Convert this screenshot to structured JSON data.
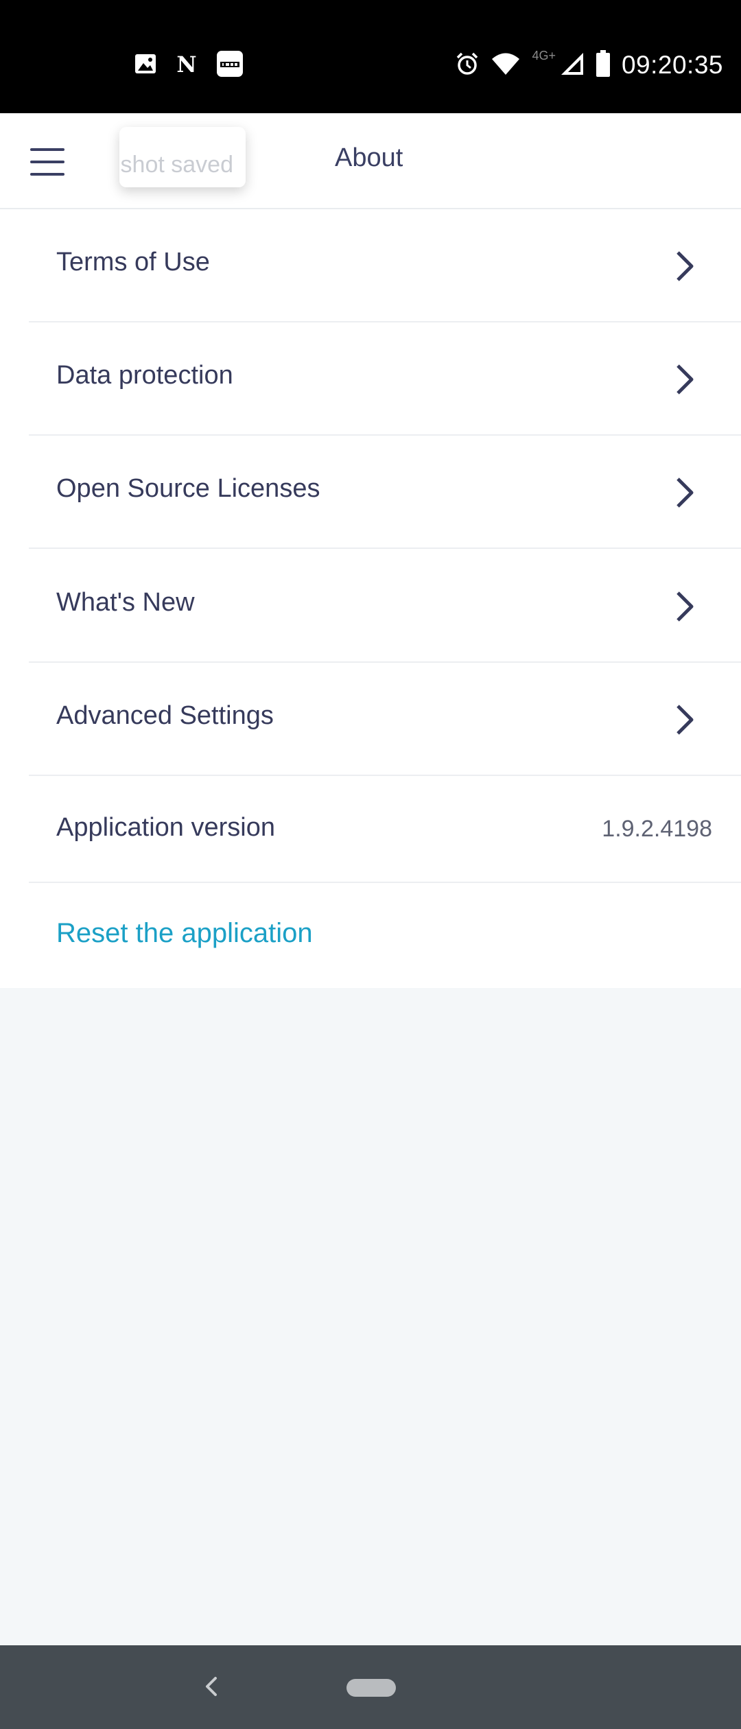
{
  "status_bar": {
    "time": "09:20:35",
    "network_label": "4G+",
    "left_icons": [
      "image-icon",
      "n-app-icon",
      "ifttt-icon"
    ],
    "right_icons": [
      "alarm-icon",
      "wifi-icon",
      "signal-icon",
      "battery-icon"
    ]
  },
  "app_bar": {
    "title": "About",
    "toast": "shot saved"
  },
  "menu": {
    "items": [
      {
        "label": "Terms of Use"
      },
      {
        "label": "Data protection"
      },
      {
        "label": "Open Source Licenses"
      },
      {
        "label": "What's New"
      },
      {
        "label": "Advanced Settings"
      }
    ],
    "version": {
      "label": "Application version",
      "value": "1.9.2.4198"
    },
    "reset_label": "Reset the application"
  },
  "colors": {
    "text": "#363a5b",
    "accent": "#1ba0c6",
    "page_background": "#f4f7f9",
    "nav_bar": "#454c52"
  }
}
